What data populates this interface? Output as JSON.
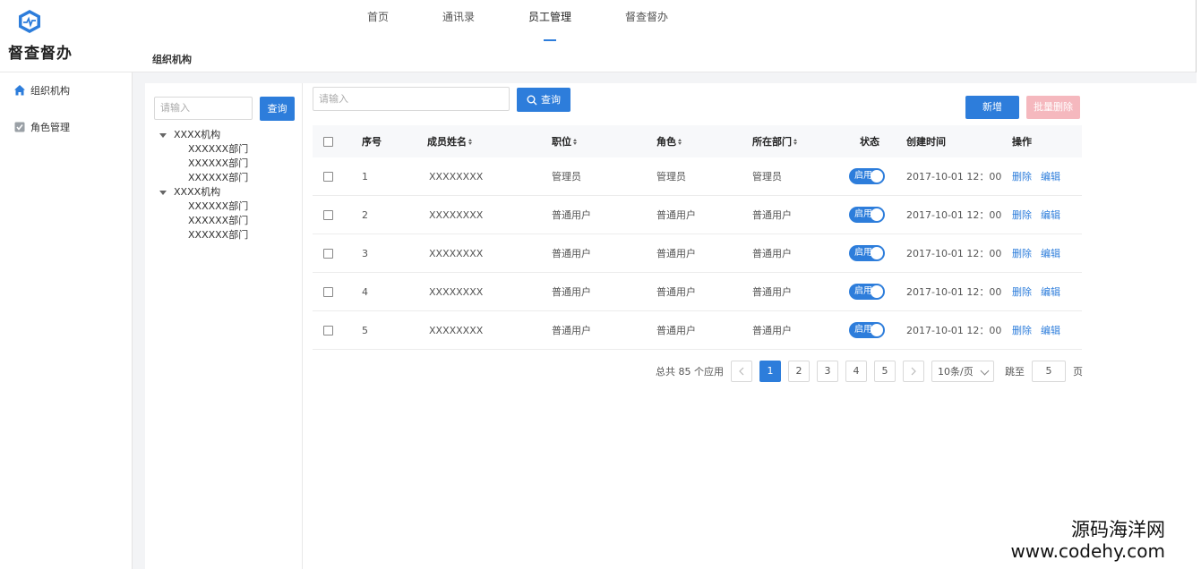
{
  "app": {
    "title": "督查督办"
  },
  "nav": {
    "items": [
      "首页",
      "通讯录",
      "员工管理",
      "督查督办"
    ],
    "active_index": 2
  },
  "breadcrumb": "组织机构",
  "sidebar": {
    "items": [
      {
        "label": "组织机构",
        "icon": "home-icon"
      },
      {
        "label": "角色管理",
        "icon": "checkbox-icon"
      }
    ]
  },
  "tree_search": {
    "placeholder": "请输入",
    "button": "查询"
  },
  "tree": [
    {
      "label": "XXXX机构",
      "children": [
        "XXXXXX部门",
        "XXXXXX部门",
        "XXXXXX部门"
      ]
    },
    {
      "label": "XXXX机构",
      "children": [
        "XXXXXX部门",
        "XXXXXX部门",
        "XXXXXX部门"
      ]
    }
  ],
  "main_search": {
    "placeholder": "请输入",
    "button": "查询"
  },
  "actions": {
    "add": "新增",
    "batch_delete": "批量删除"
  },
  "table": {
    "headers": {
      "index": "序号",
      "name": "成员姓名",
      "position": "职位",
      "role": "角色",
      "department": "所在部门",
      "status": "状态",
      "created": "创建时间",
      "ops": "操作"
    },
    "rows": [
      {
        "index": "1",
        "name": "XXXXXXXX",
        "position": "管理员",
        "role": "管理员",
        "department": "管理员",
        "status": "启用",
        "created": "2017-10-01 12：00",
        "delete": "删除",
        "edit": "编辑"
      },
      {
        "index": "2",
        "name": "XXXXXXXX",
        "position": "普通用户",
        "role": "普通用户",
        "department": "普通用户",
        "status": "启用",
        "created": "2017-10-01 12：00",
        "delete": "删除",
        "edit": "编辑"
      },
      {
        "index": "3",
        "name": "XXXXXXXX",
        "position": "普通用户",
        "role": "普通用户",
        "department": "普通用户",
        "status": "启用",
        "created": "2017-10-01 12：00",
        "delete": "删除",
        "edit": "编辑"
      },
      {
        "index": "4",
        "name": "XXXXXXXX",
        "position": "普通用户",
        "role": "普通用户",
        "department": "普通用户",
        "status": "启用",
        "created": "2017-10-01 12：00",
        "delete": "删除",
        "edit": "编辑"
      },
      {
        "index": "5",
        "name": "XXXXXXXX",
        "position": "普通用户",
        "role": "普通用户",
        "department": "普通用户",
        "status": "启用",
        "created": "2017-10-01 12：00",
        "delete": "删除",
        "edit": "编辑"
      }
    ]
  },
  "pagination": {
    "total_text": "总共 85 个应用",
    "pages": [
      "1",
      "2",
      "3",
      "4",
      "5"
    ],
    "current": "1",
    "page_size": "10条/页",
    "jump_label": "跳至",
    "jump_value": "5",
    "page_unit": "页"
  },
  "watermark": {
    "line1": "源码海洋网",
    "line2": "www.codehy.com"
  },
  "colors": {
    "primary": "#2d7ddb",
    "disabled_danger": "#f5b8be"
  }
}
